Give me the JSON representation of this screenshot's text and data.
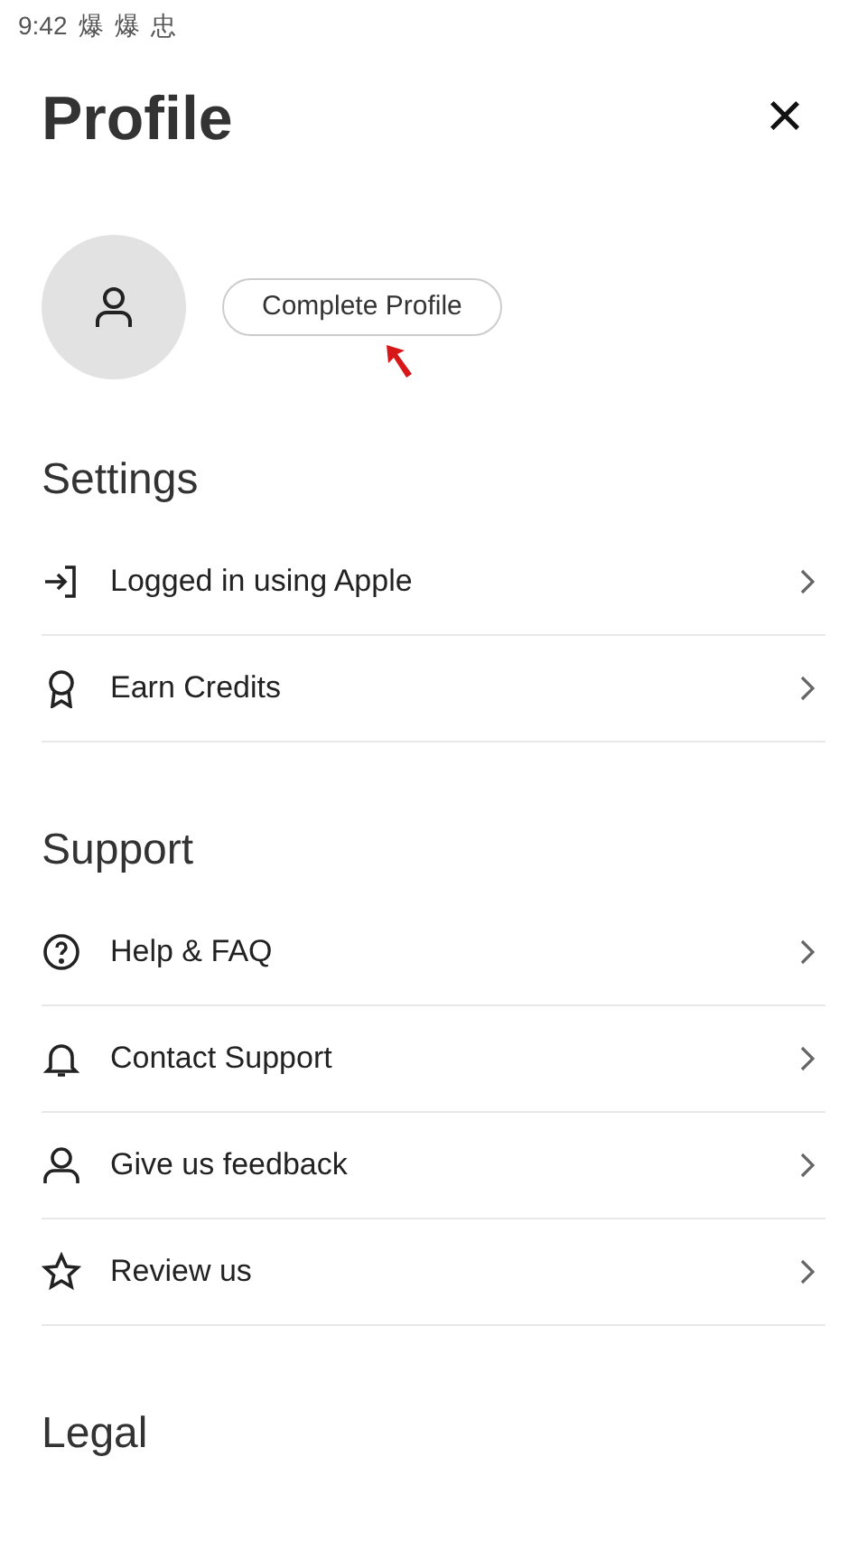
{
  "status_bar": {
    "time": "9:42",
    "notification_glyphs": [
      "爆",
      "爆",
      "忠"
    ]
  },
  "header": {
    "title": "Profile",
    "close": "×"
  },
  "profile": {
    "button": "Complete Profile"
  },
  "sections": [
    {
      "title": "Settings",
      "items": [
        {
          "label": "Logged in using Apple"
        },
        {
          "label": "Earn Credits"
        }
      ]
    },
    {
      "title": "Support",
      "items": [
        {
          "label": "Help & FAQ"
        },
        {
          "label": "Contact Support"
        },
        {
          "label": "Give us feedback"
        },
        {
          "label": "Review us"
        }
      ]
    },
    {
      "title": "Legal"
    }
  ]
}
